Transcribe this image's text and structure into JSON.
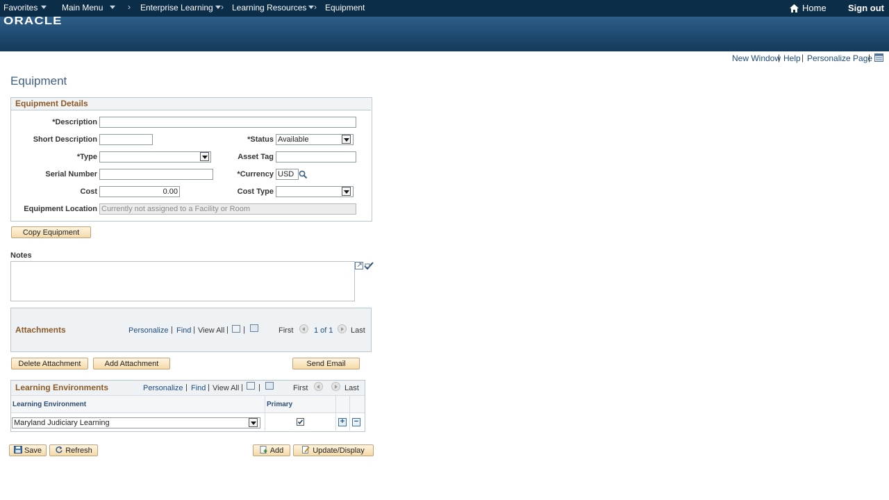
{
  "nav": {
    "favorites": "Favorites",
    "main_menu": "Main Menu",
    "breadcrumb": [
      "Enterprise Learning",
      "Learning Resources",
      "Equipment"
    ],
    "home": "Home",
    "sign_out": "Sign out"
  },
  "brand": {
    "logo": "ORACLE"
  },
  "page_links": {
    "new_window": "New Window",
    "help": "Help",
    "personalize_page": "Personalize Page"
  },
  "page": {
    "title": "Equipment"
  },
  "equipment_details": {
    "header": "Equipment Details",
    "description_label": "*Description",
    "description_value": "",
    "short_description_label": "Short Description",
    "short_description_value": "",
    "status_label": "*Status",
    "status_value": "Available",
    "type_label": "*Type",
    "type_value": "",
    "asset_tag_label": "Asset Tag",
    "asset_tag_value": "",
    "serial_number_label": "Serial Number",
    "serial_number_value": "",
    "currency_label": "*Currency",
    "currency_value": "USD",
    "cost_label": "Cost",
    "cost_value": "0.00",
    "cost_type_label": "Cost Type",
    "cost_type_value": "",
    "location_label": "Equipment Location",
    "location_value": "Currently not assigned to a Facility or Room"
  },
  "buttons": {
    "copy_equipment": "Copy Equipment",
    "delete_attachment": "Delete Attachment",
    "add_attachment": "Add Attachment",
    "send_email": "Send Email",
    "save": "Save",
    "refresh": "Refresh",
    "add": "Add",
    "update_display": "Update/Display"
  },
  "notes": {
    "label": "Notes",
    "value": ""
  },
  "attachments": {
    "title": "Attachments",
    "personalize": "Personalize",
    "find": "Find",
    "view_all": "View All",
    "first": "First",
    "range": "1 of 1",
    "last": "Last"
  },
  "learning_environments": {
    "title": "Learning Environments",
    "personalize": "Personalize",
    "find": "Find",
    "view_all": "View All",
    "first": "First",
    "last": "Last",
    "col_environment": "Learning Environment",
    "col_primary": "Primary",
    "rows": [
      {
        "environment": "Maryland Judiciary Learning",
        "primary": true
      }
    ]
  },
  "colors": {
    "nav_bg": "#0c2d47",
    "brand_bg": "#1e4a70",
    "section_title": "#8d5a25",
    "link": "#1c4a7d",
    "button_bg": "#f5d9a8"
  }
}
